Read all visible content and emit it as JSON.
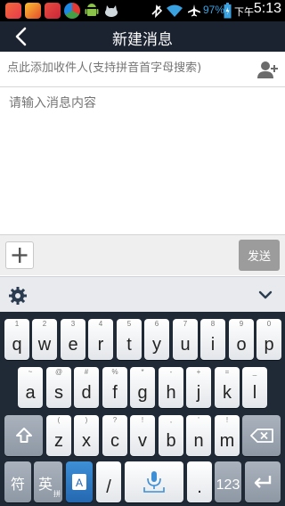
{
  "status_bar": {
    "battery": "97%",
    "ampm": "下午",
    "time": "5:13"
  },
  "header": {
    "title": "新建消息"
  },
  "recipients": {
    "placeholder": "点此添加收件人(支持拼音首字母搜索)"
  },
  "message": {
    "placeholder": "请输入消息内容"
  },
  "compose_bar": {
    "send_label": "发送"
  },
  "keyboard": {
    "row1": [
      {
        "ch": "q",
        "alt": "1"
      },
      {
        "ch": "w",
        "alt": "2"
      },
      {
        "ch": "e",
        "alt": "3"
      },
      {
        "ch": "r",
        "alt": "4"
      },
      {
        "ch": "t",
        "alt": "5"
      },
      {
        "ch": "y",
        "alt": "6"
      },
      {
        "ch": "u",
        "alt": "7"
      },
      {
        "ch": "i",
        "alt": "8"
      },
      {
        "ch": "o",
        "alt": "9"
      },
      {
        "ch": "p",
        "alt": "0"
      }
    ],
    "row2": [
      {
        "ch": "a",
        "alt": "~"
      },
      {
        "ch": "s",
        "alt": "@"
      },
      {
        "ch": "d",
        "alt": "#"
      },
      {
        "ch": "f",
        "alt": "%"
      },
      {
        "ch": "g",
        "alt": "*"
      },
      {
        "ch": "h",
        "alt": "-"
      },
      {
        "ch": "j",
        "alt": "+"
      },
      {
        "ch": "k",
        "alt": "="
      },
      {
        "ch": "l",
        "alt": "_"
      }
    ],
    "row3": [
      {
        "ch": "z",
        "alt": "("
      },
      {
        "ch": "x",
        "alt": ")"
      },
      {
        "ch": "c",
        "alt": "?"
      },
      {
        "ch": "v",
        "alt": "!"
      },
      {
        "ch": "b",
        "alt": ","
      },
      {
        "ch": "n",
        "alt": "'"
      },
      {
        "ch": "m",
        "alt": "!"
      }
    ],
    "symbols_label": "符",
    "lang_label": "英",
    "lang_sub": "拼",
    "slash_label": "/",
    "period_label": ".",
    "numbers_label": "123"
  }
}
